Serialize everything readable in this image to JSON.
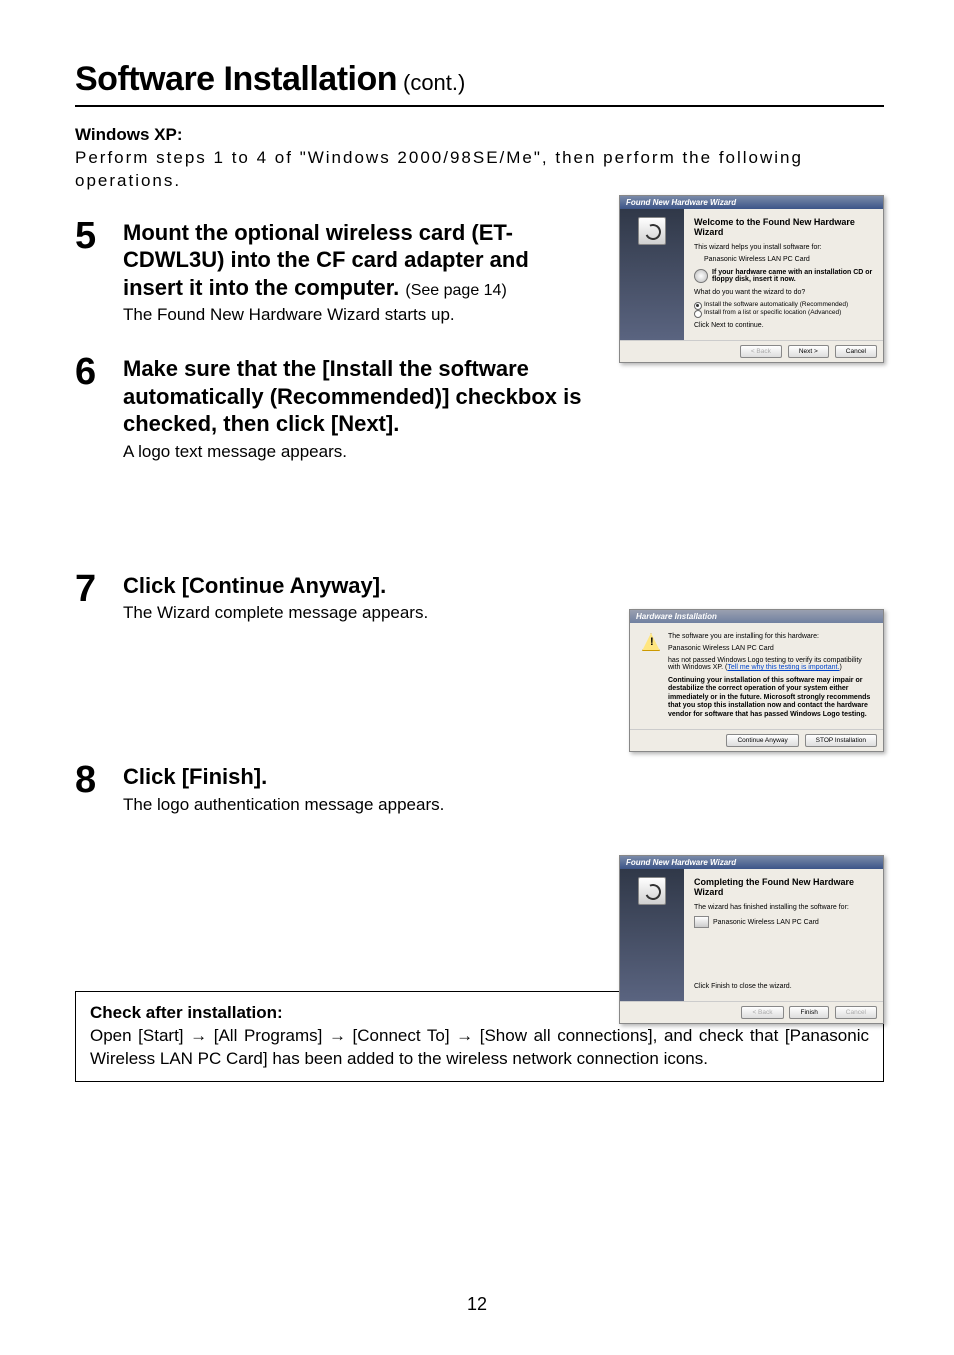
{
  "title": "Software Installation",
  "title_cont": "(cont.)",
  "os_section": "Windows XP:",
  "intro": "Perform steps 1 to 4 of \"Windows 2000/98SE/Me\", then perform the following operations.",
  "steps": {
    "s5": {
      "num": "5",
      "heading": "Mount the optional wireless card (ET-CDWL3U) into the CF card adapter and insert it into the computer.",
      "sub": "(See page 14)",
      "desc": "The Found New Hardware Wizard starts up."
    },
    "s6": {
      "num": "6",
      "heading": "Make sure that the [Install the software automatically (Recommended)] checkbox is checked, then click [Next].",
      "desc": "A logo text message appears."
    },
    "s7": {
      "num": "7",
      "heading": "Click [Continue Anyway].",
      "desc": "The Wizard complete message appears."
    },
    "s8": {
      "num": "8",
      "heading": "Click [Finish].",
      "desc": "The logo authentication message appears."
    }
  },
  "dialog1": {
    "title": "Found New Hardware Wizard",
    "h": "Welcome to the Found New Hardware Wizard",
    "l1": "This wizard helps you install software for:",
    "l2": "Panasonic Wireless LAN PC Card",
    "cd": "If your hardware came with an installation CD or floppy disk, insert it now.",
    "q": "What do you want the wizard to do?",
    "r1": "Install the software automatically (Recommended)",
    "r2": "Install from a list or specific location (Advanced)",
    "cont": "Click Next to continue.",
    "back": "< Back",
    "next": "Next >",
    "cancel": "Cancel"
  },
  "dialog2": {
    "title": "Hardware Installation",
    "l1": "The software you are installing for this hardware:",
    "l2": "Panasonic Wireless LAN PC Card",
    "l3a": "has not passed Windows Logo testing to verify its compatibility with Windows XP. (",
    "l3link": "Tell me why this testing is important.",
    "l3b": ")",
    "bold": "Continuing your installation of this software may impair or destabilize the correct operation of your system either immediately or in the future. Microsoft strongly recommends that you stop this installation now and contact the hardware vendor for software that has passed Windows Logo testing.",
    "btn1": "Continue Anyway",
    "btn2": "STOP Installation"
  },
  "dialog3": {
    "title": "Found New Hardware Wizard",
    "h": "Completing the Found New Hardware Wizard",
    "l1": "The wizard has finished installing the software for:",
    "l2": "Panasonic Wireless LAN PC Card",
    "cont": "Click Finish to close the wizard.",
    "back": "< Back",
    "finish": "Finish",
    "cancel": "Cancel"
  },
  "checkbox": {
    "hdr": "Check after installation:",
    "body": "Open [Start] → [All Programs] → [Connect To] → [Show all connections], and check that [Panasonic Wireless LAN PC Card] has been added to the wireless network connection icons."
  },
  "pagenum": "12"
}
